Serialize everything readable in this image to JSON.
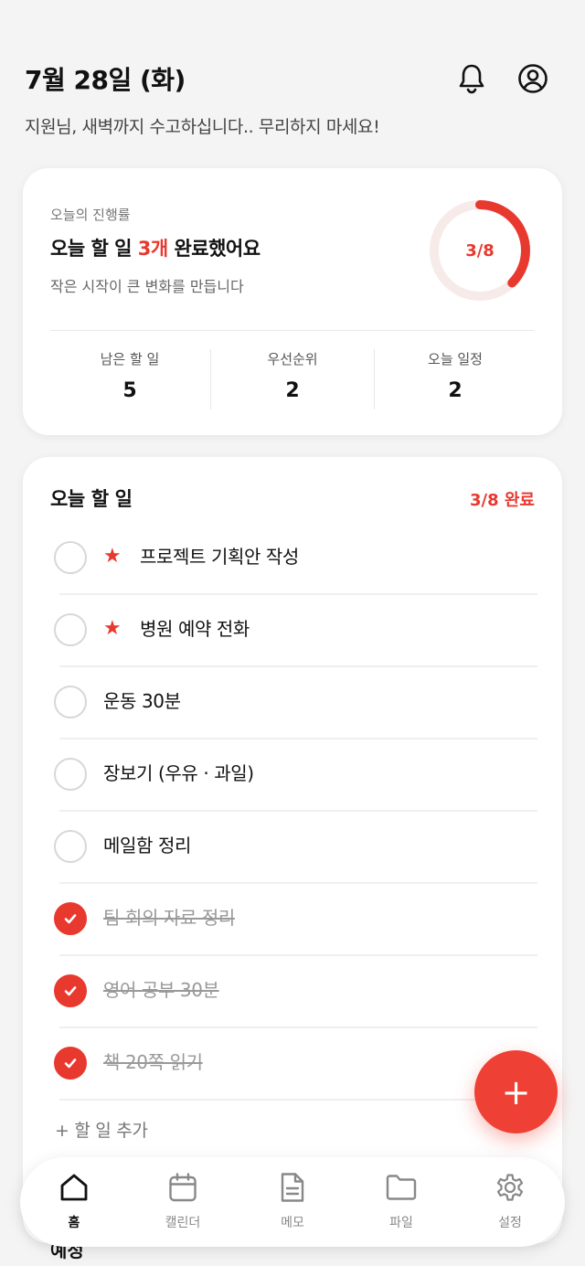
{
  "header": {
    "date": "7월 28일 (화)",
    "greeting": "지원님, 새벽까지 수고하십니다.. 무리하지 마세요!",
    "icons": [
      "bell-icon",
      "user-icon"
    ]
  },
  "progress": {
    "label": "오늘의 진행률",
    "title_prefix": "오늘 할 일 ",
    "title_highlight": "3개",
    "title_suffix": " 완료했어요",
    "subtitle": "작은 시작이 큰 변화를 만듭니다",
    "ring_text": "3/8",
    "completed": 3,
    "total": 8,
    "stats": [
      {
        "label": "남은 할 일",
        "value": "5"
      },
      {
        "label": "우선순위",
        "value": "2"
      },
      {
        "label": "오늘 일정",
        "value": "2"
      }
    ]
  },
  "todos": {
    "title": "오늘 할 일",
    "count_text": "3/8 완료",
    "items": [
      {
        "text": "프로젝트 기획안 작성",
        "priority": true,
        "done": false
      },
      {
        "text": "병원 예약 전화",
        "priority": true,
        "done": false
      },
      {
        "text": "운동 30분",
        "priority": false,
        "done": false
      },
      {
        "text": "장보기 (우유 · 과일)",
        "priority": false,
        "done": false
      },
      {
        "text": "메일함 정리",
        "priority": false,
        "done": false
      },
      {
        "text": "팀 회의 자료 정리",
        "priority": false,
        "done": true
      },
      {
        "text": "영어 공부 30분",
        "priority": false,
        "done": true
      },
      {
        "text": "책 20쪽 읽기",
        "priority": false,
        "done": true
      }
    ],
    "add_label": "+ 할 일 추가",
    "star_glyph": "★"
  },
  "peek_section": "예정",
  "fab": {
    "label": "+"
  },
  "nav": {
    "items": [
      {
        "label": "홈",
        "icon": "home-icon",
        "active": true
      },
      {
        "label": "캘린더",
        "icon": "calendar-icon",
        "active": false
      },
      {
        "label": "메모",
        "icon": "memo-icon",
        "active": false
      },
      {
        "label": "파일",
        "icon": "folder-icon",
        "active": false
      },
      {
        "label": "설정",
        "icon": "gear-icon",
        "active": false
      }
    ]
  },
  "colors": {
    "accent": "#e8392f",
    "background": "#f4f4f4",
    "card": "#ffffff"
  }
}
